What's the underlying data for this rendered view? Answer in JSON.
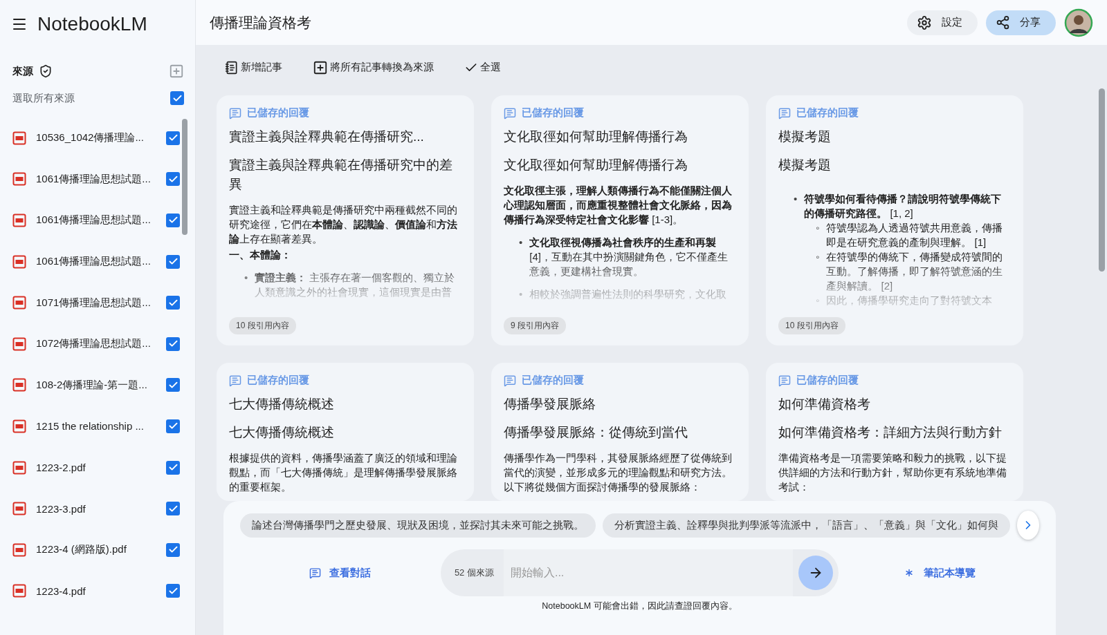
{
  "app": {
    "logo": "NotebookLM"
  },
  "sources": {
    "heading": "來源",
    "select_all": {
      "label": "選取所有來源",
      "checked": true
    },
    "items": [
      {
        "name": "10536_1042傳播理論...",
        "checked": true
      },
      {
        "name": "1061傳播理論思想試題...",
        "checked": true
      },
      {
        "name": "1061傳播理論思想試題...",
        "checked": true
      },
      {
        "name": "1061傳播理論思想試題...",
        "checked": true
      },
      {
        "name": "1071傳播理論思想試題...",
        "checked": true
      },
      {
        "name": "1072傳播理論思想試題...",
        "checked": true
      },
      {
        "name": "108-2傳播理論-第一題...",
        "checked": true
      },
      {
        "name": "1215 the relationship ...",
        "checked": true
      },
      {
        "name": "1223-2.pdf",
        "checked": true
      },
      {
        "name": "1223-3.pdf",
        "checked": true
      },
      {
        "name": "1223-4 (網路版).pdf",
        "checked": true
      },
      {
        "name": "1223-4.pdf",
        "checked": true
      }
    ]
  },
  "notebook": {
    "title": "傳播理論資格考"
  },
  "header_actions": [
    {
      "label": "設定",
      "kind": "settings"
    },
    {
      "label": "分享",
      "kind": "share"
    }
  ],
  "toolbar": [
    {
      "label": "新增記事",
      "kind": "note"
    },
    {
      "label": "將所有記事轉換為來源",
      "kind": "convert"
    },
    {
      "label": "全選",
      "kind": "select"
    }
  ],
  "notes": [
    {
      "tag": "已儲存的回覆",
      "title": "實證主義與詮釋典範在傳播研究...",
      "heading": "實證主義與詮釋典範在傳播研究中的差異",
      "blocks": [
        {
          "kind": "para",
          "text": "實證主義和詮釋典範是傳播研究中兩種截然不同的研究途徑，它們在**本體論**、**認識論**、**價值論**和**方法論**上存在顯著差異。"
        },
        {
          "kind": "heading",
          "text": "一、本體論："
        },
        {
          "kind": "bullet",
          "marker": "•",
          "text": "**實證主義：** 主張存在著一個客觀的、獨立於人類意識之外的社會現實，這個現實是由普"
        }
      ],
      "citations": "10 段引用內容"
    },
    {
      "tag": "已儲存的回覆",
      "title": "文化取徑如何幫助理解傳播行為",
      "heading": "文化取徑如何幫助理解傳播行為",
      "blocks": [
        {
          "kind": "para",
          "text": "**文化取徑主張，理解人類傳播行為不能僅關注個人心理認知層面，而應重視整體社會文化脈絡，因為傳播行為深受特定社會文化影響** [1-3]。"
        },
        {
          "kind": "bullet",
          "marker": "•",
          "text": "**文化取徑視傳播為社會秩序的生產和再製** [4]，互動在其中扮演關鍵角色，它不僅產生意義，更建構社會現實。"
        },
        {
          "kind": "bullet",
          "marker": "•",
          "text": "相較於強調普遍性法則的科學研究，文化取"
        }
      ],
      "citations": "9 段引用內容"
    },
    {
      "tag": "已儲存的回覆",
      "title": "模擬考題",
      "heading": "模擬考題",
      "blocks": [
        {
          "kind": "bullet",
          "marker": "•",
          "text": "**符號學如何看待傳播？請說明符號學傳統下的傳播研究路徑。** [1, 2]"
        },
        {
          "kind": "subbullet",
          "marker": "◦",
          "text": "符號學認為人透過符號共用意義，傳播即是在研究意義的產制與理解。 [1]"
        },
        {
          "kind": "subbullet",
          "marker": "◦",
          "text": "在符號學的傳統下，傳播變成符號間的互動。了解傳播，即了解符號意涵的生產與解讀。 [2]"
        },
        {
          "kind": "subbullet",
          "marker": "◦",
          "text": "因此，傳播學研究走向了對符號文本"
        }
      ],
      "citations": "10 段引用內容"
    },
    {
      "tag": "已儲存的回覆",
      "title": "七大傳播傳統概述",
      "heading": "七大傳播傳統概述",
      "blocks": [
        {
          "kind": "para",
          "text": "根據提供的資料，傳播學涵蓋了廣泛的領域和理論觀點，而「七大傳播傳統」是理解傳播學發展脈絡的重要框架。"
        }
      ]
    },
    {
      "tag": "已儲存的回覆",
      "title": "傳播學發展脈絡",
      "heading": "傳播學發展脈絡：從傳統到當代",
      "blocks": [
        {
          "kind": "para",
          "text": "傳播學作為一門學科，其發展脈絡經歷了從傳統到當代的演變，並形成多元的理論觀點和研究方法。以下將從幾個方面探討傳播學的發展脈絡："
        }
      ]
    },
    {
      "tag": "已儲存的回覆",
      "title": "如何準備資格考",
      "heading": "如何準備資格考：詳細方法與行動方針",
      "blocks": [
        {
          "kind": "para",
          "text": "準備資格考是一項需要策略和毅力的挑戰，以下提供詳細的方法和行動方針，幫助你更有系統地準備考試："
        }
      ]
    }
  ],
  "chat": {
    "suggestions": [
      "論述台灣傳播學門之歷史發展、現狀及困境，並探討其未來可能之挑戰。",
      "分析實證主義、詮釋學與批判學派等流派中，「語言」、「意義」與「文化」如何與"
    ],
    "history_button": "查看對話",
    "source_count": "52 個來源",
    "placeholder": "開始輸入...",
    "guide_button": "筆記本導覽",
    "disclaimer": "NotebookLM 可能會出錯，因此請查證回覆內容。"
  }
}
